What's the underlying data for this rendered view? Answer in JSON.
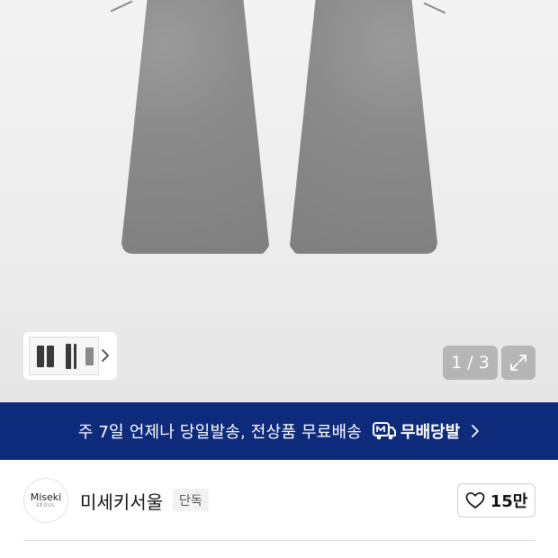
{
  "gallery": {
    "page_current": "1",
    "page_separator": "/",
    "page_total": "3"
  },
  "banner": {
    "text": "주 7일 언제나 당일발송, 전상품 무료배송",
    "badge_text": "무배당발",
    "background_color": "#0e2a7a"
  },
  "brand": {
    "logo_text": "Miseki",
    "logo_subtext": "SEOUL",
    "name": "미세키서울",
    "badge": "단독",
    "like_count": "15만"
  },
  "icons": {
    "thumb_arrow": "chevron-right-icon",
    "expand": "expand-icon",
    "delivery": "delivery-truck-icon",
    "banner_arrow": "chevron-right-icon",
    "like": "heart-icon"
  }
}
